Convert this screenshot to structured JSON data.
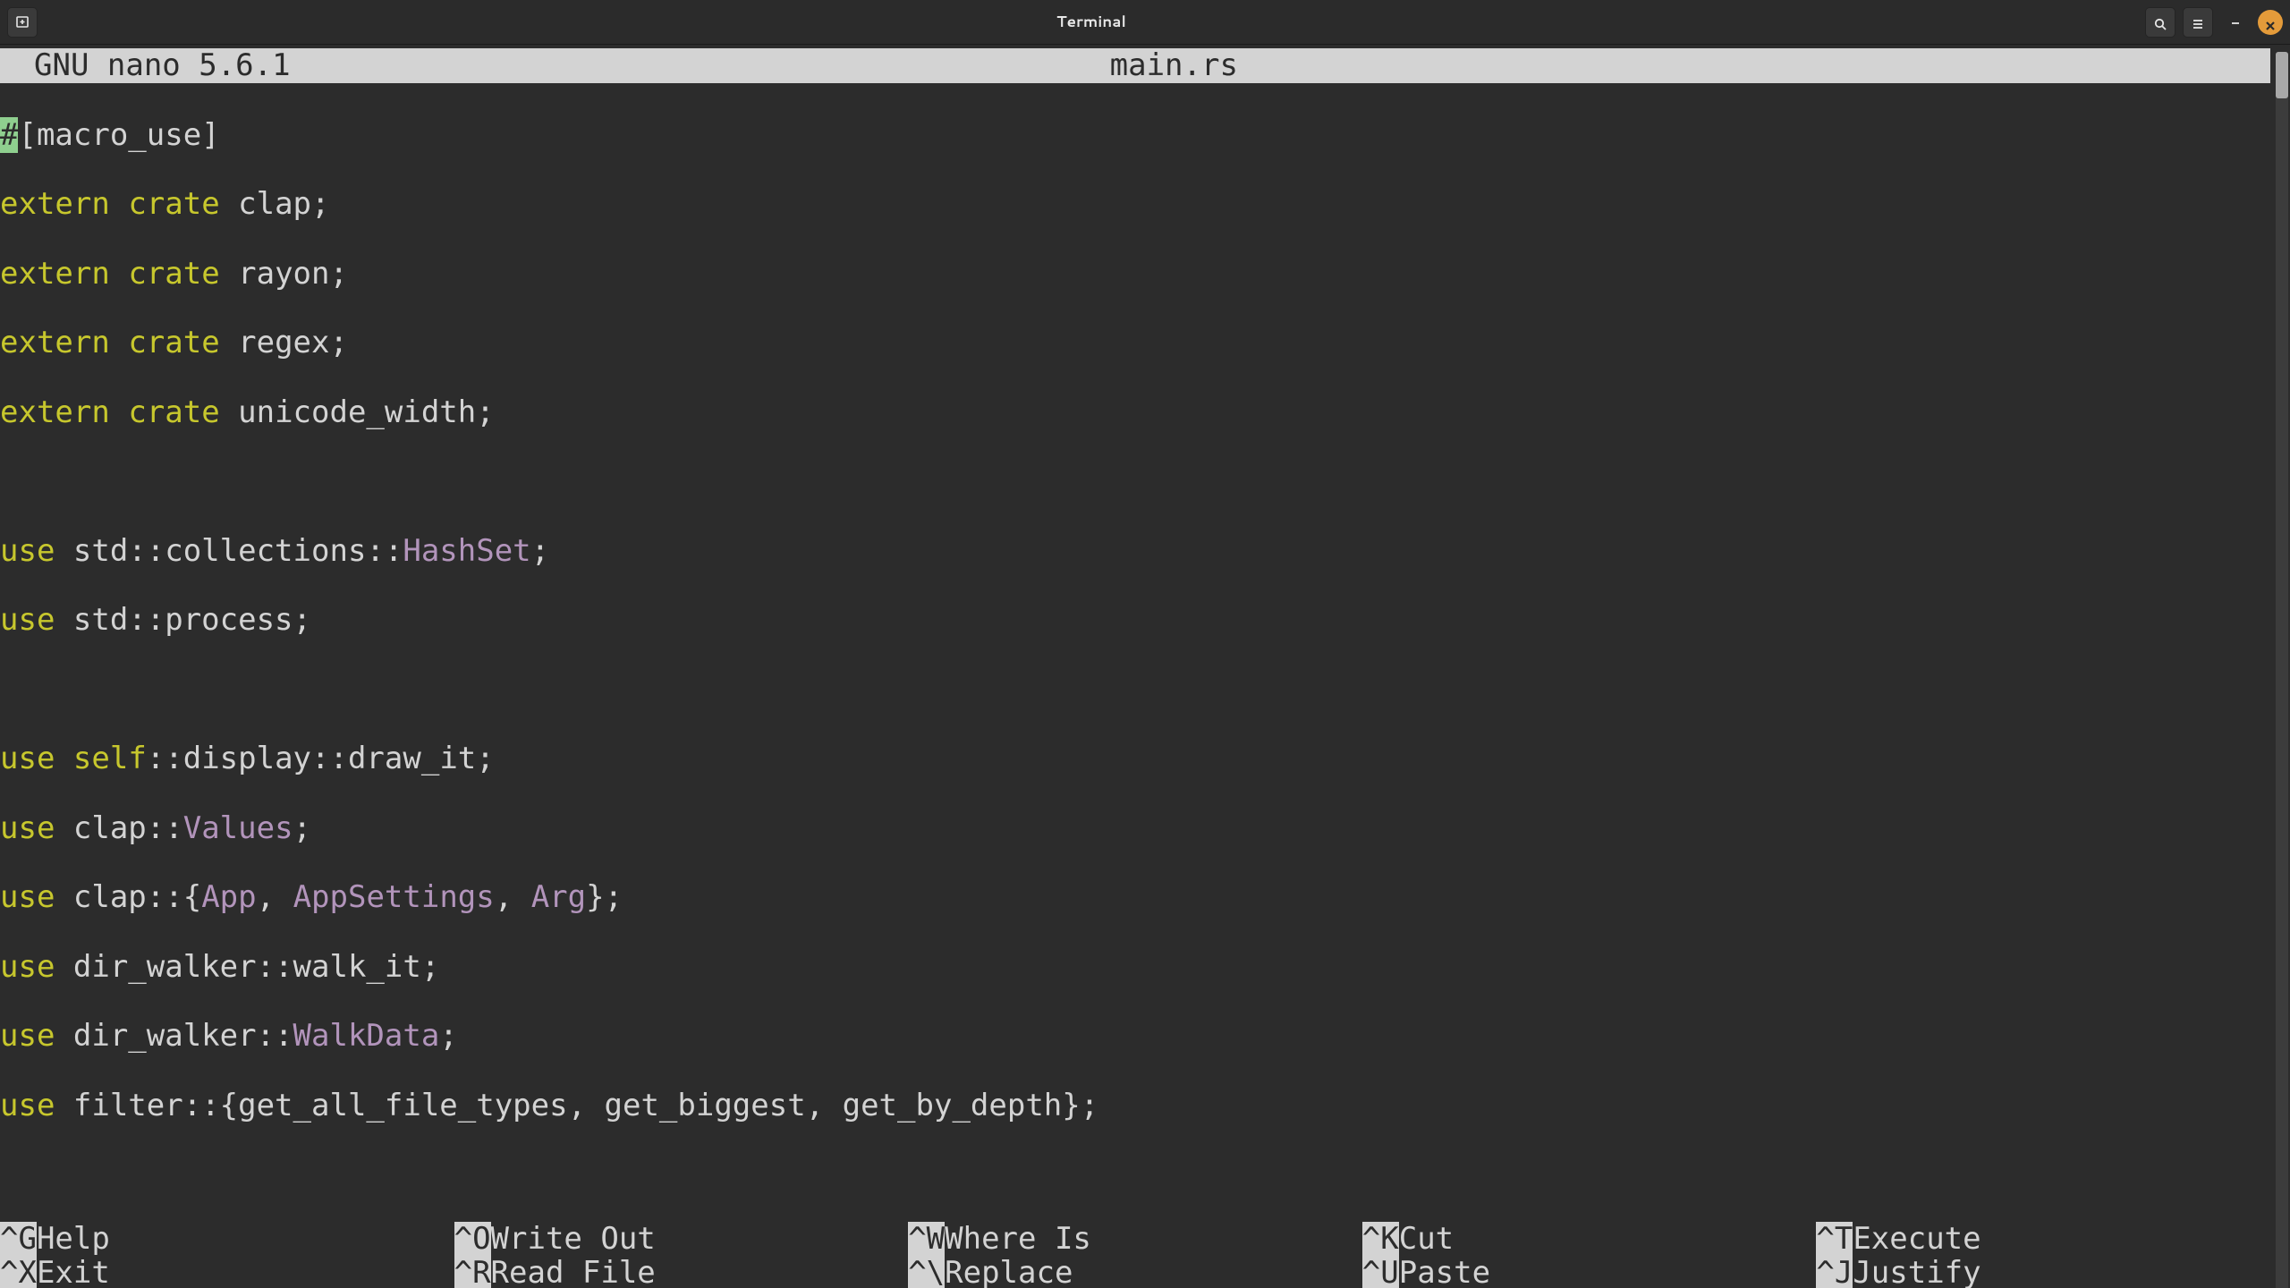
{
  "window": {
    "title": "Terminal"
  },
  "nano": {
    "app_name": "GNU nano 5.6.1",
    "filename": "main.rs"
  },
  "syntax": {
    "extern": "extern",
    "crate": "crate",
    "use": "use",
    "self": "self"
  },
  "types": {
    "HashSet": "HashSet",
    "Values": "Values",
    "App": "App",
    "AppSettings": "AppSettings",
    "Arg": "Arg",
    "WalkData": "WalkData"
  },
  "code": {
    "l1_hash": "#",
    "l1_rest": "[macro_use]",
    "l2_rest": " clap;",
    "l3_rest": " rayon;",
    "l4_rest": " regex;",
    "l5_rest": " unicode_width;",
    "l7_mid": " std::collections::",
    "l7_end": ";",
    "l8_rest": " std::process;",
    "l10_mid1": " ",
    "l10_mid2": "::display::draw_it;",
    "l11_mid": " clap::",
    "l11_end": ";",
    "l12_mid": " clap::{",
    "l12_c1": ", ",
    "l12_c2": ", ",
    "l12_end": "};",
    "l13_rest": " dir_walker::walk_it;",
    "l14_mid": " dir_walker::",
    "l14_end": ";",
    "l15_rest": " filter::{get_all_file_types, get_biggest, get_by_depth};"
  },
  "shortcuts": {
    "r1": [
      {
        "key": "^G",
        "label": " Help"
      },
      {
        "key": "^O",
        "label": " Write Out"
      },
      {
        "key": "^W",
        "label": " Where Is"
      },
      {
        "key": "^K",
        "label": " Cut"
      },
      {
        "key": "^T",
        "label": " Execute"
      }
    ],
    "r2": [
      {
        "key": "^X",
        "label": " Exit"
      },
      {
        "key": "^R",
        "label": " Read File"
      },
      {
        "key": "^\\",
        "label": " Replace"
      },
      {
        "key": "^U",
        "label": " Paste"
      },
      {
        "key": "^J",
        "label": " Justify"
      }
    ]
  }
}
